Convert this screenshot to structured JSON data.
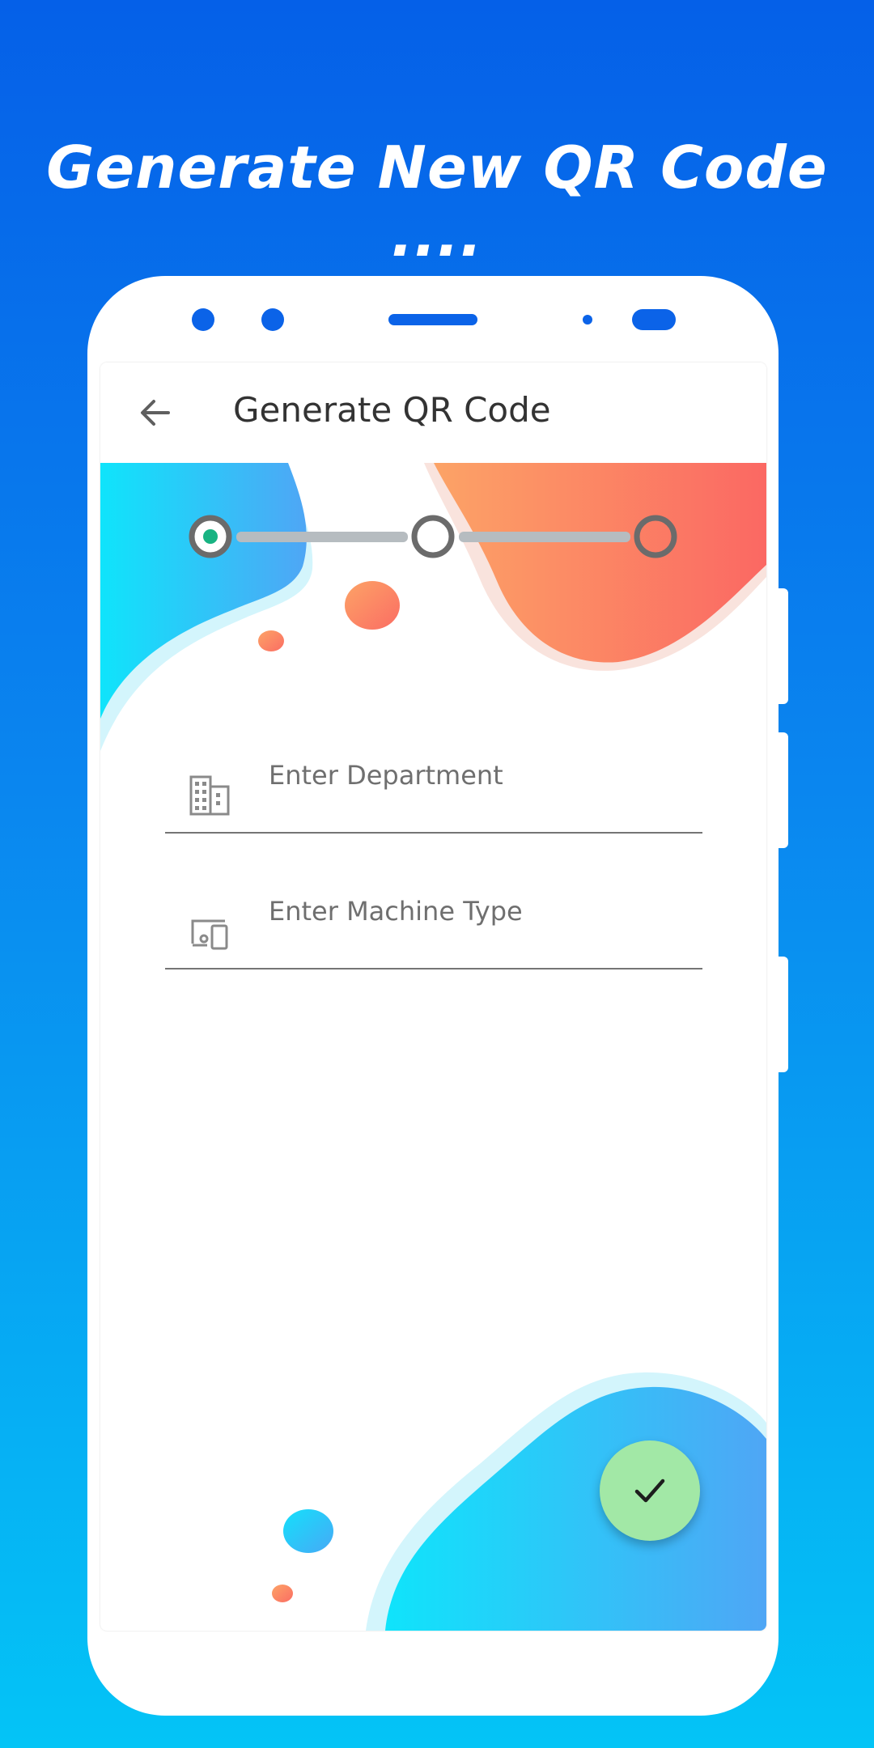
{
  "promo": {
    "headline": "Generate New QR Code ...."
  },
  "app": {
    "appbar": {
      "title": "Generate QR Code",
      "back_icon": "arrow-back-icon"
    },
    "stepper": {
      "steps": [
        {
          "state": "active"
        },
        {
          "state": "inactive"
        },
        {
          "state": "inactive"
        }
      ],
      "active_color": "#18b382",
      "ring_color": "#6b6b6b",
      "line_color": "#b6bcc0"
    },
    "form": {
      "department": {
        "placeholder": "Enter Department",
        "value": "",
        "icon": "building-icon"
      },
      "machine_type": {
        "placeholder": "Enter Machine Type",
        "value": "",
        "icon": "devices-icon"
      }
    },
    "fab": {
      "icon": "check-icon",
      "color": "#a2e8a6"
    }
  },
  "colors": {
    "brand_blue": "#0560e8",
    "accent_orange": "#fb6d64"
  }
}
